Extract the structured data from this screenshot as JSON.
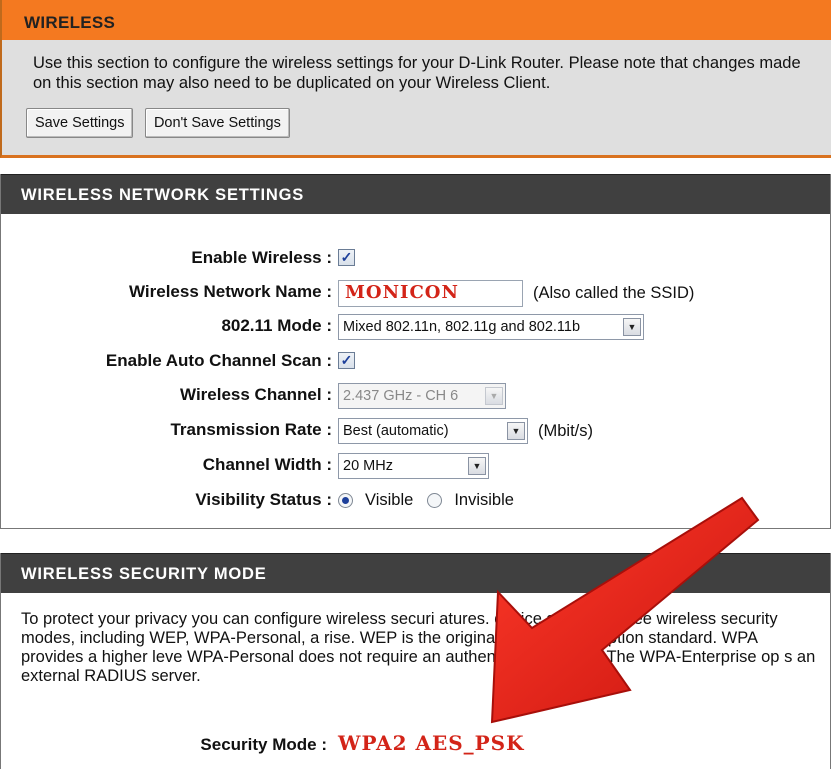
{
  "wireless": {
    "title": "WIRELESS",
    "description": "Use this section to configure the wireless settings for your D-Link Router. Please note that changes made on this section may also need to be duplicated on your Wireless Client.",
    "save_label": "Save Settings",
    "dont_save_label": "Don't Save Settings"
  },
  "network_settings": {
    "title": "WIRELESS NETWORK SETTINGS",
    "enable_wireless": {
      "label": "Enable Wireless :",
      "checked": true
    },
    "network_name": {
      "label": "Wireless Network Name :",
      "value": "MONICON",
      "note": "(Also called the SSID)"
    },
    "mode": {
      "label": "802.11 Mode :",
      "value": "Mixed 802.11n, 802.11g and 802.11b"
    },
    "auto_channel": {
      "label": "Enable Auto Channel Scan :",
      "checked": true
    },
    "channel": {
      "label": "Wireless Channel :",
      "value": "2.437 GHz - CH 6"
    },
    "tx_rate": {
      "label": "Transmission Rate :",
      "value": "Best (automatic)",
      "note": "(Mbit/s)"
    },
    "channel_width": {
      "label": "Channel Width :",
      "value": "20 MHz"
    },
    "visibility": {
      "label": "Visibility Status :",
      "option_visible": "Visible",
      "option_invisible": "Invisible",
      "selected": "Visible"
    }
  },
  "security": {
    "title": "WIRELESS SECURITY MODE",
    "description": "To protect your privacy you can configure wireless securi      atures.       device supports three wireless security modes, including WEP, WPA-Personal, a          rise. WEP is the original wireless encryption standard. WPA provides a higher leve          WPA-Personal does not require an authentication server. The WPA-Enterprise op          s an external RADIUS server.",
    "mode_label": "Security Mode :",
    "mode_value": "WPA2 AES_PSK"
  },
  "colors": {
    "header_orange": "#f47920",
    "section_dark": "#404040",
    "highlight_red": "#d32418",
    "arrow_red": "#e0201a"
  },
  "icons": {
    "checkbox": "check-icon",
    "dropdown": "chevron-down-icon",
    "annotation": "red-arrow"
  }
}
